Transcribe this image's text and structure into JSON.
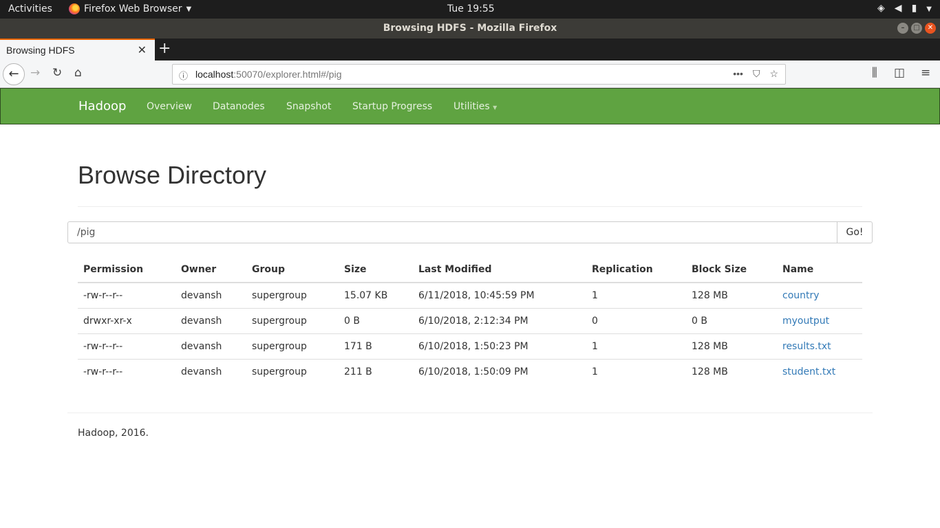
{
  "system": {
    "activities": "Activities",
    "app_name": "Firefox Web Browser",
    "clock": "Tue 19:55"
  },
  "window": {
    "title": "Browsing HDFS - Mozilla Firefox"
  },
  "browser": {
    "tab_title": "Browsing HDFS",
    "url_host": "localhost",
    "url_rest": ":50070/explorer.html#/pig"
  },
  "hadoop_nav": {
    "brand": "Hadoop",
    "items": [
      "Overview",
      "Datanodes",
      "Snapshot",
      "Startup Progress",
      "Utilities"
    ]
  },
  "page": {
    "title": "Browse Directory",
    "path_value": "/pig",
    "go_label": "Go!",
    "footer": "Hadoop, 2016."
  },
  "table": {
    "headers": [
      "Permission",
      "Owner",
      "Group",
      "Size",
      "Last Modified",
      "Replication",
      "Block Size",
      "Name"
    ],
    "rows": [
      {
        "permission": "-rw-r--r--",
        "owner": "devansh",
        "group": "supergroup",
        "size": "15.07 KB",
        "modified": "6/11/2018, 10:45:59 PM",
        "replication": "1",
        "block_size": "128 MB",
        "name": "country"
      },
      {
        "permission": "drwxr-xr-x",
        "owner": "devansh",
        "group": "supergroup",
        "size": "0 B",
        "modified": "6/10/2018, 2:12:34 PM",
        "replication": "0",
        "block_size": "0 B",
        "name": "myoutput"
      },
      {
        "permission": "-rw-r--r--",
        "owner": "devansh",
        "group": "supergroup",
        "size": "171 B",
        "modified": "6/10/2018, 1:50:23 PM",
        "replication": "1",
        "block_size": "128 MB",
        "name": "results.txt"
      },
      {
        "permission": "-rw-r--r--",
        "owner": "devansh",
        "group": "supergroup",
        "size": "211 B",
        "modified": "6/10/2018, 1:50:09 PM",
        "replication": "1",
        "block_size": "128 MB",
        "name": "student.txt"
      }
    ]
  },
  "colors": {
    "hadoop_green": "#5fa341",
    "link_blue": "#337ab7",
    "tab_accent": "#e66000"
  }
}
